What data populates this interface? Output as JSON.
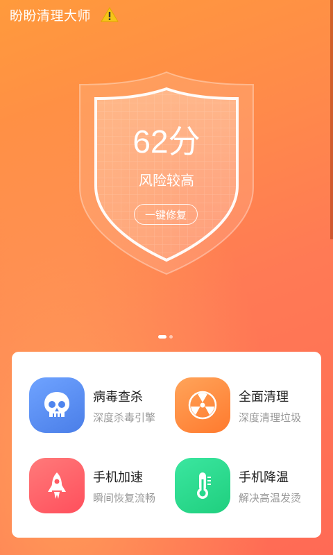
{
  "app": {
    "title": "盼盼清理大师",
    "warning_icon": "warning-triangle-icon"
  },
  "score": {
    "value": "62分",
    "status": "风险较高",
    "fix_button": "一键修复"
  },
  "pager": {
    "pages": 2,
    "current": 1
  },
  "features": [
    {
      "title": "病毒查杀",
      "subtitle": "深度杀毒引擎",
      "icon": "skull-icon",
      "color": "#5b8ff0"
    },
    {
      "title": "全面清理",
      "subtitle": "深度清理垃圾",
      "icon": "radiation-icon",
      "color": "#ff8a3d"
    },
    {
      "title": "手机加速",
      "subtitle": "瞬间恢复流畅",
      "icon": "rocket-icon",
      "color": "#ff6266"
    },
    {
      "title": "手机降温",
      "subtitle": "解决高温发烫",
      "icon": "thermometer-icon",
      "color": "#27d88c"
    }
  ],
  "colors": {
    "background_start": "#ff9a3c",
    "background_end": "#ff6a55"
  }
}
